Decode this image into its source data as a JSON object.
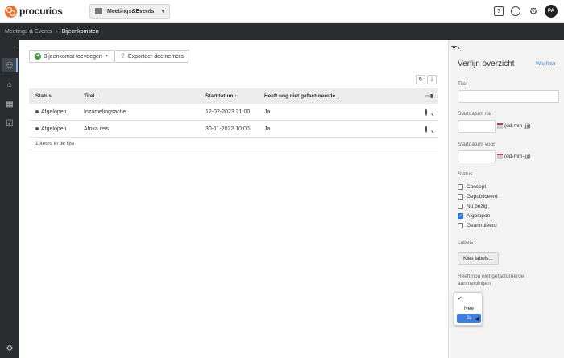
{
  "brand": {
    "name": "procurios"
  },
  "app_selector": {
    "label": "Meetings&Events"
  },
  "header_icons": {
    "help": "?",
    "search": "search-icon",
    "settings": "gear-icon",
    "avatar": "PA"
  },
  "breadcrumb": {
    "parent": "Meetings & Events",
    "separator": "›",
    "current": "Bijeenkomsten"
  },
  "toolbar": {
    "add_label": "Bijeenkomst toevoegen",
    "export_label": "Exporteer deelnemers"
  },
  "table": {
    "columns": [
      "Status",
      "Titel",
      "Startdatum",
      "Heeft nog niet gefactureerde..."
    ],
    "sort_markers": {
      "title": "↓",
      "startdate": "↕"
    },
    "rows": [
      {
        "status": "Afgelopen",
        "title": "Inzamelingsactie",
        "start": "12-02-2023 21:00",
        "unbilled": "Ja"
      },
      {
        "status": "Afgelopen",
        "title": "Afrika reis",
        "start": "30-11-2022 10:00",
        "unbilled": "Ja"
      }
    ],
    "footer": "1 items in de lijst"
  },
  "filter": {
    "title": "Verfijn overzicht",
    "clear": "Wis filter",
    "title_label": "Titel",
    "start_after_label": "Startdatum na",
    "start_before_label": "Startdatum voor",
    "date_hint": "(dd-mm-jjjj)",
    "status_label": "Status",
    "statuses": [
      {
        "label": "Concept",
        "checked": false
      },
      {
        "label": "Gepubliceerd",
        "checked": false
      },
      {
        "label": "Nu bezig",
        "checked": false
      },
      {
        "label": "Afgelopen",
        "checked": true
      },
      {
        "label": "Geannuleerd",
        "checked": false
      }
    ],
    "labels_label": "Labels",
    "labels_button": "Kies labels...",
    "unbilled_label": "Heeft nog niet gefactureerde aanmeldingen",
    "unbilled_options": [
      "",
      "Nee",
      "Ja"
    ],
    "unbilled_selected": "Ja"
  },
  "colors": {
    "accent": "#3d7ee0",
    "dark": "#2a2d30",
    "brand": "#e8722c"
  }
}
